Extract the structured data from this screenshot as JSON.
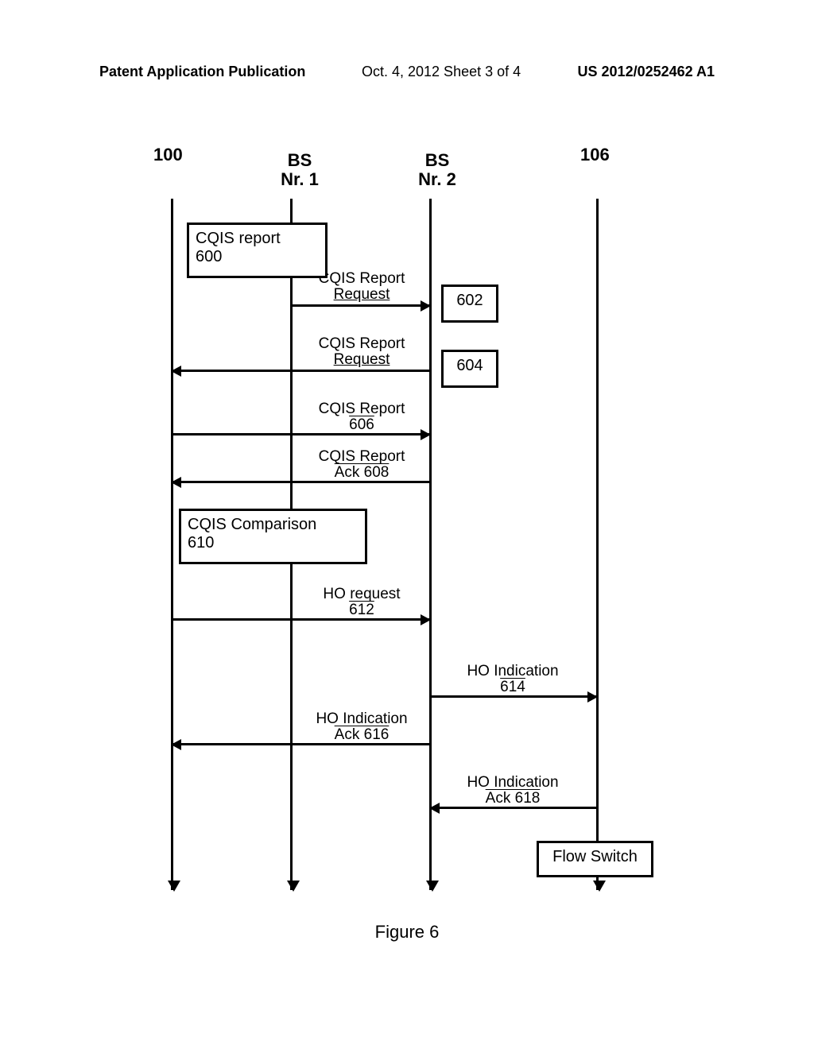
{
  "header": {
    "left_label": "Patent Application Publication",
    "center_label": "Oct. 4, 2012   Sheet 3 of 4",
    "right_label": "US 2012/0252462 A1"
  },
  "figure_caption": "Figure 6",
  "lanes": {
    "lane_100": "100",
    "lane_bs1_line1": "BS",
    "lane_bs1_line2": "Nr. 1",
    "lane_bs2_line1": "BS",
    "lane_bs2_line2": "Nr. 2",
    "lane_106": "106"
  },
  "boxes": {
    "b600_line1": "CQIS report",
    "b600_line2": "600",
    "b602": "602",
    "b604": "604",
    "b610_line1": "CQIS Comparison",
    "b610_line2": "610",
    "bflow": "Flow Switch"
  },
  "messages": {
    "m_req_1_line1": "CQIS Report",
    "m_req_1_line2": "Request",
    "m_req_2_line1": "CQIS Report",
    "m_req_2_line2": "Request",
    "m_606_line1": "CQIS Report",
    "m_606_line2": "606",
    "m_608_line1": "CQIS Report",
    "m_608_line2": "Ack 608",
    "m_612_line1": "HO request",
    "m_612_line2": "612",
    "m_614_line1": "HO Indication",
    "m_614_line2": "614",
    "m_616_line1": "HO Indication",
    "m_616_line2": "Ack 616",
    "m_618_line1": "HO Indication",
    "m_618_line2": "Ack 618"
  }
}
